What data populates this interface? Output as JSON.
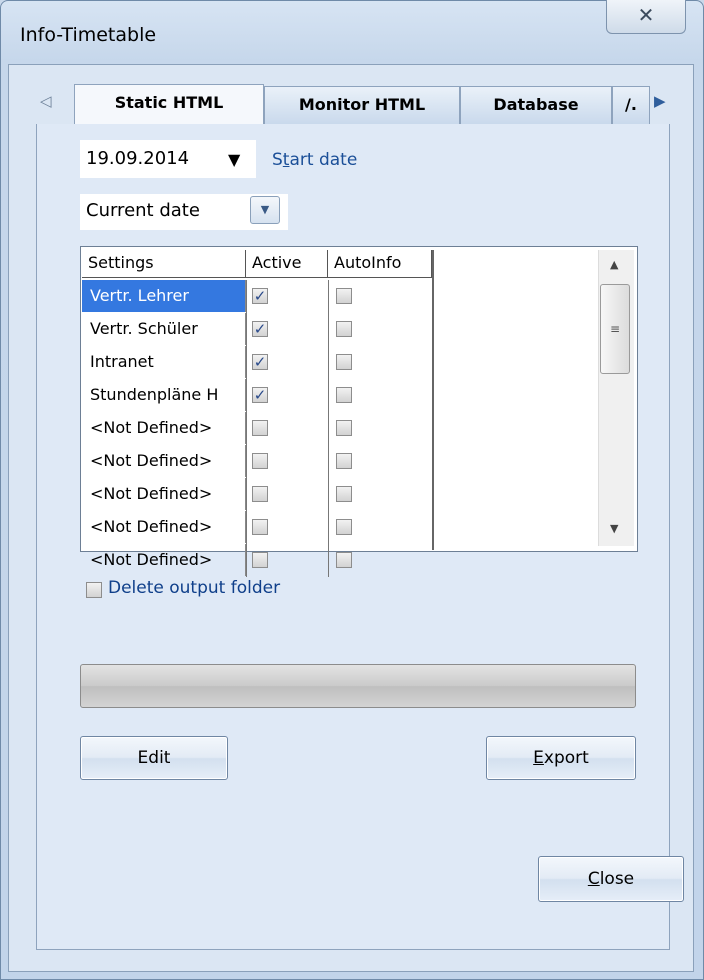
{
  "window": {
    "title": "Info-Timetable",
    "close_glyph": "✕"
  },
  "tabs": {
    "nav_left": "◁",
    "nav_right": "▶",
    "items": [
      {
        "label": "Static HTML",
        "active": true
      },
      {
        "label": "Monitor HTML",
        "active": false
      },
      {
        "label": "Database",
        "active": false
      },
      {
        "label": "/.",
        "active": false
      }
    ]
  },
  "date_combo": {
    "value": "19.09.2014",
    "arrow": "▼"
  },
  "start_date": {
    "first": "S",
    "underlined": "t",
    "rest": "art date"
  },
  "current_combo": {
    "value": "Current date",
    "arrow": "▼"
  },
  "grid": {
    "headers": [
      "Settings",
      "Active",
      "AutoInfo"
    ],
    "rows": [
      {
        "name": "Vertr. Lehrer",
        "active": true,
        "autoinfo": false,
        "selected": true
      },
      {
        "name": "Vertr. Schüler",
        "active": true,
        "autoinfo": false,
        "selected": false
      },
      {
        "name": "Intranet",
        "active": true,
        "autoinfo": false,
        "selected": false
      },
      {
        "name": "Stundenpläne H",
        "active": true,
        "autoinfo": false,
        "selected": false
      },
      {
        "name": "<Not Defined>",
        "active": false,
        "autoinfo": false,
        "selected": false
      },
      {
        "name": "<Not Defined>",
        "active": false,
        "autoinfo": false,
        "selected": false
      },
      {
        "name": "<Not Defined>",
        "active": false,
        "autoinfo": false,
        "selected": false
      },
      {
        "name": "<Not Defined>",
        "active": false,
        "autoinfo": false,
        "selected": false
      },
      {
        "name": "<Not Defined>",
        "active": false,
        "autoinfo": false,
        "selected": false
      }
    ],
    "scroll_up": "▲",
    "scroll_down": "▼",
    "thumb_grip": "≡"
  },
  "delete_output": {
    "label": "Delete output folder",
    "checked": false
  },
  "progress": {
    "fraction": 0.0
  },
  "buttons": {
    "edit": "Edit",
    "export": {
      "first": "E",
      "rest": "xport"
    },
    "close": {
      "first": "C",
      "rest": "lose"
    }
  },
  "colors": {
    "accent": "#3478e0",
    "link": "#1b4f98",
    "frame": "#c9d8ea"
  }
}
